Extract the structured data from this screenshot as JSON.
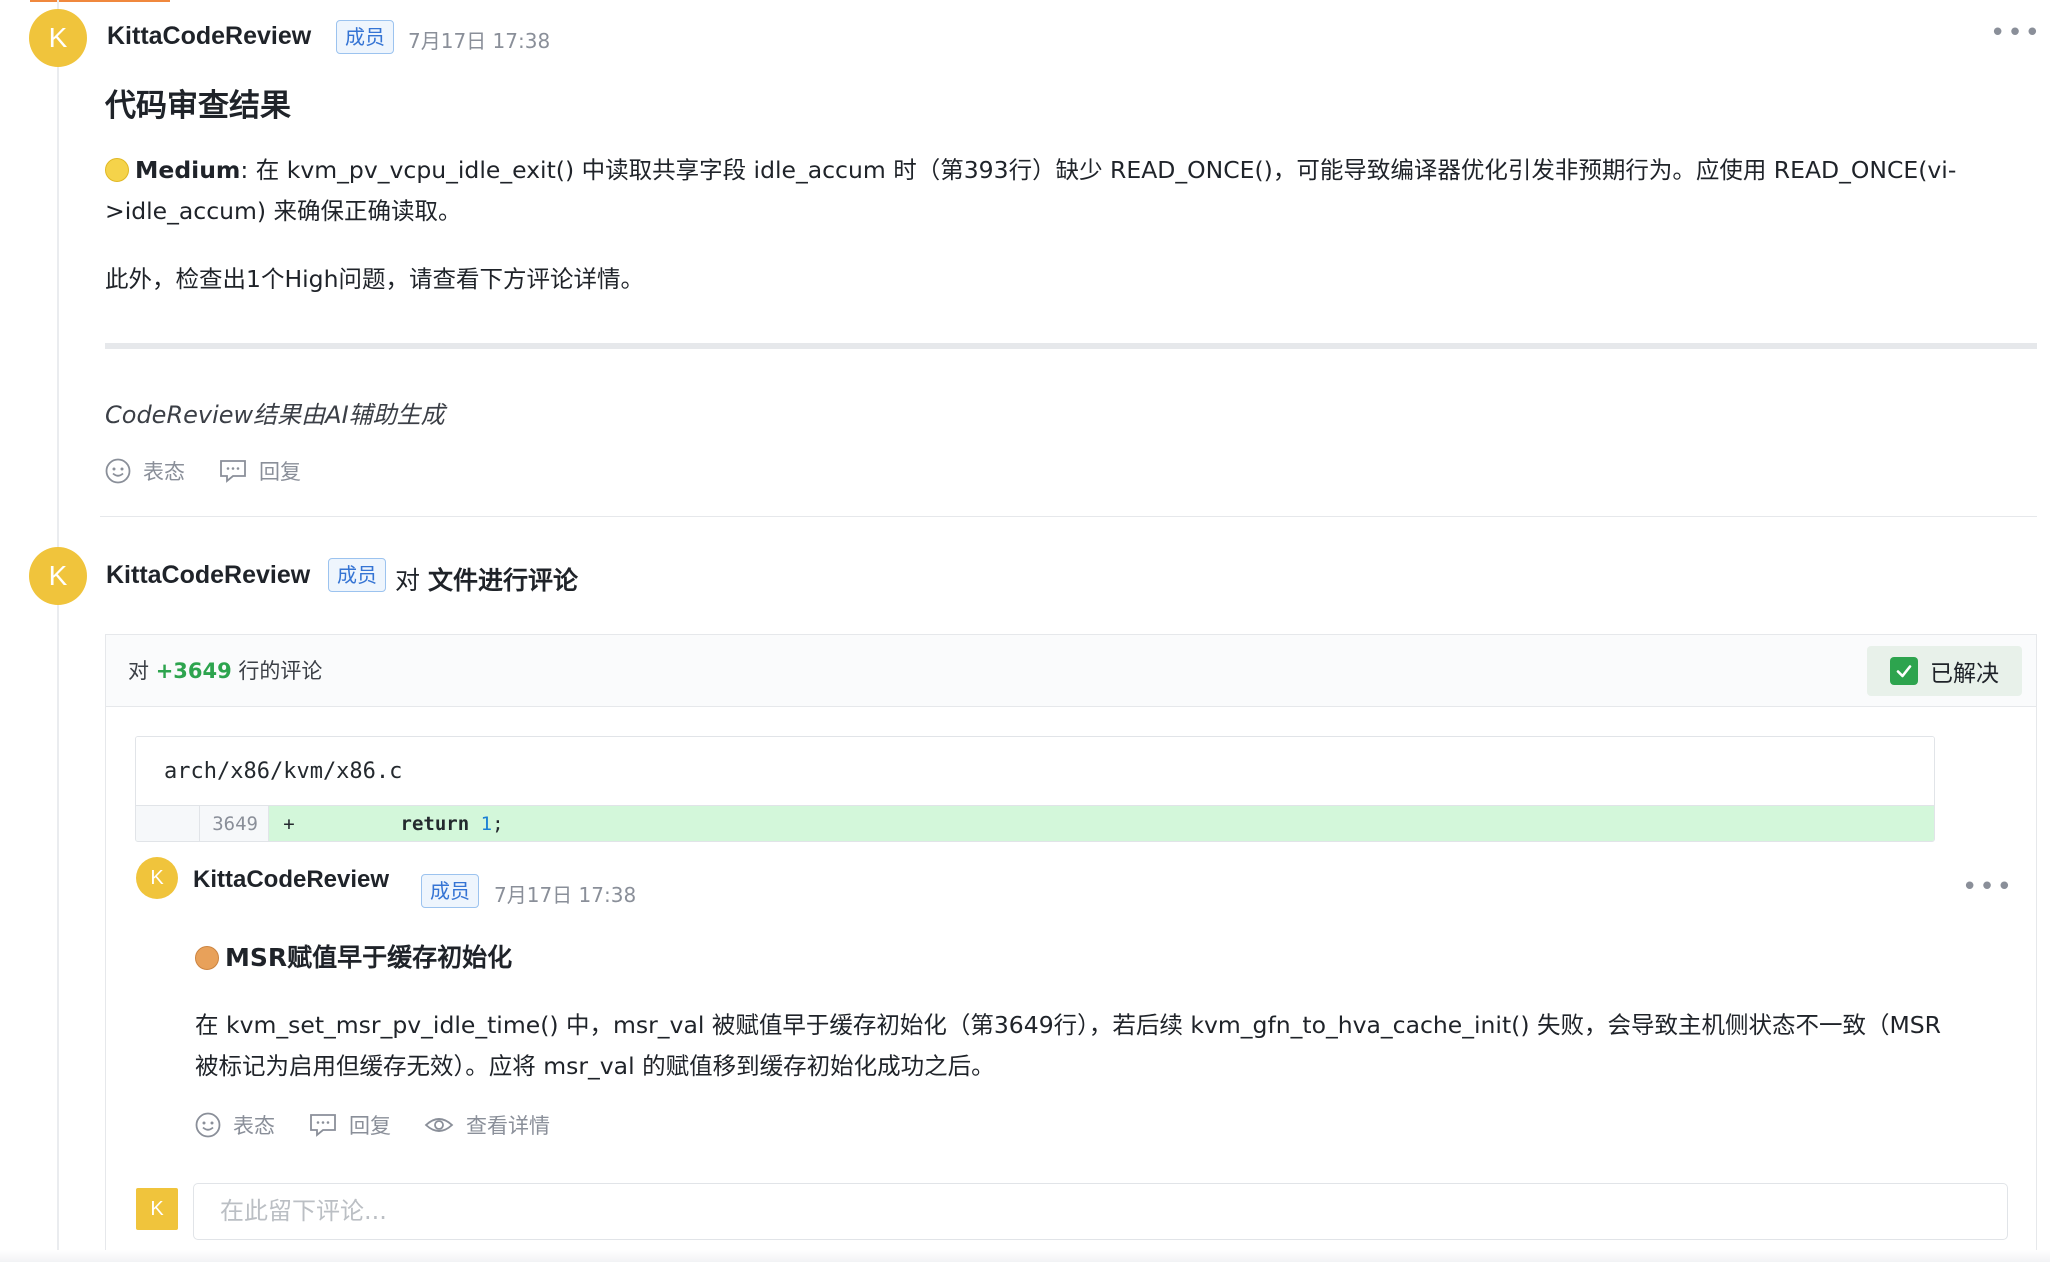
{
  "top_comment": {
    "avatar_letter": "K",
    "author": "KittaCodeReview",
    "badge": "成员",
    "timestamp": "7月17日 17:38",
    "more_label": "•••",
    "title": "代码审查结果",
    "medium_severity": "Medium",
    "medium_text": ": 在 kvm_pv_vcpu_idle_exit() 中读取共享字段 idle_accum 时（第393行）缺少 READ_ONCE()，可能导致编译器优化引发非预期行为。应使用 READ_ONCE(vi->idle_accum) 来确保正确读取。",
    "summary": "此外，检查出1个High问题，请查看下方评论详情。",
    "ai_note": "CodeReview结果由AI辅助生成",
    "react_label": "表态",
    "reply_label": "回复"
  },
  "file_comment": {
    "avatar_letter": "K",
    "author": "KittaCodeReview",
    "badge": "成员",
    "prefix": "对",
    "target": "文件进行评论",
    "line_prefix": "对",
    "line_number": "+3649",
    "line_suffix": "行的评论",
    "resolved_label": "已解决",
    "code": {
      "file_path": "arch/x86/kvm/x86.c",
      "line_no": "3649",
      "sign": "+",
      "indent": "        ",
      "keyword": "return",
      "number": "1",
      "semicolon": ";"
    },
    "reply": {
      "avatar_letter": "K",
      "author": "KittaCodeReview",
      "badge": "成员",
      "timestamp": "7月17日 17:38",
      "more_label": "•••",
      "title": "MSR赋值早于缓存初始化",
      "body": "在 kvm_set_msr_pv_idle_time() 中，msr_val 被赋值早于缓存初始化（第3649行），若后续 kvm_gfn_to_hva_cache_init() 失败，会导致主机侧状态不一致（MSR 被标记为启用但缓存无效）。应将 msr_val 的赋值移到缓存初始化成功之后。",
      "react_label": "表态",
      "reply_label": "回复",
      "details_label": "查看详情"
    },
    "composer": {
      "avatar_letter": "K",
      "placeholder": "在此留下评论..."
    }
  },
  "colors": {
    "avatar": "#f0c43c",
    "badge_text": "#3574d4",
    "resolved_check": "#2da44e",
    "added_line_bg": "#d3f7da"
  }
}
